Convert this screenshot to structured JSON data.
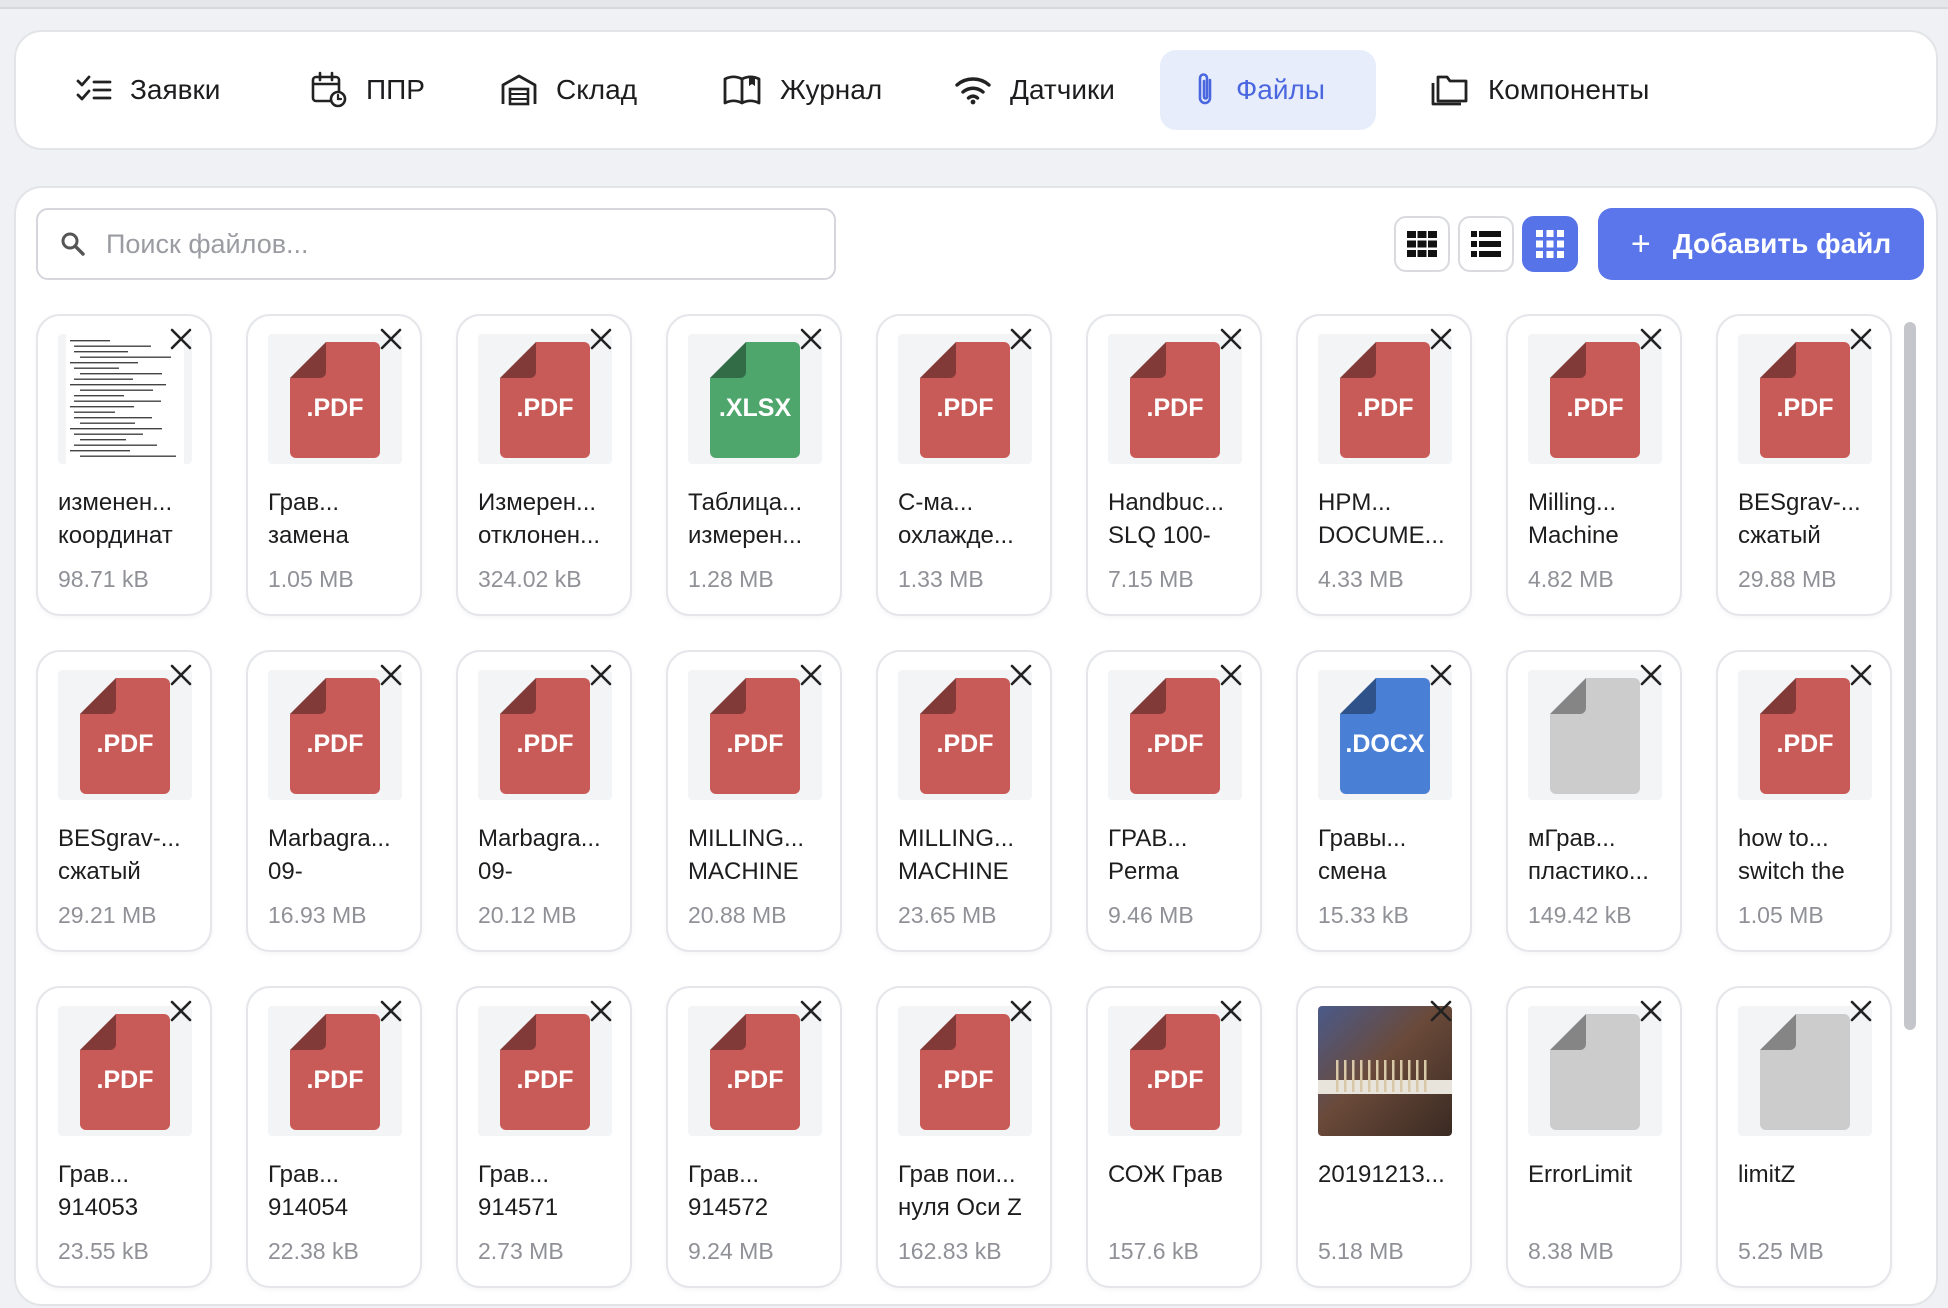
{
  "nav": {
    "items": [
      {
        "label": "Заявки",
        "icon": "checklist-icon"
      },
      {
        "label": "ППР",
        "icon": "calendar-refresh-icon"
      },
      {
        "label": "Склад",
        "icon": "warehouse-icon"
      },
      {
        "label": "Журнал",
        "icon": "book-icon"
      },
      {
        "label": "Датчики",
        "icon": "wifi-icon"
      },
      {
        "label": "Файлы",
        "icon": "paperclip-icon",
        "active": true
      },
      {
        "label": "Компоненты",
        "icon": "folders-icon"
      }
    ]
  },
  "search": {
    "placeholder": "Поиск файлов...",
    "value": ""
  },
  "toolbar": {
    "views": [
      "large-grid-icon",
      "list-icon",
      "small-grid-icon"
    ],
    "active_view": "small-grid-icon",
    "add_label": "Добавить файл",
    "add_icon": "plus-icon"
  },
  "colors": {
    "accent": "#5a76ea",
    "pdf": "#c85a57",
    "xlsx": "#4ea66c",
    "docx": "#4a7fd6",
    "unknown": "#cccccc"
  },
  "files": [
    {
      "type": "doc-preview",
      "ext": "",
      "line1": "изменен...",
      "line2": "координат",
      "size": "98.71 kB"
    },
    {
      "type": "pdf",
      "ext": ".PDF",
      "line1": "Грав...",
      "line2": "замена",
      "size": "1.05 MB"
    },
    {
      "type": "pdf",
      "ext": ".PDF",
      "line1": "Измерен...",
      "line2": "отклонен...",
      "size": "324.02 kB"
    },
    {
      "type": "xlsx",
      "ext": ".XLSX",
      "line1": "Таблица...",
      "line2": "измерен...",
      "size": "1.28 MB"
    },
    {
      "type": "pdf",
      "ext": ".PDF",
      "line1": "C-ма...",
      "line2": "охлажде...",
      "size": "1.33 MB"
    },
    {
      "type": "pdf",
      "ext": ".PDF",
      "line1": "Handbuc...",
      "line2": "SLQ 100-",
      "size": "7.15 MB"
    },
    {
      "type": "pdf",
      "ext": ".PDF",
      "line1": "HPM...",
      "line2": "DOCUME...",
      "size": "4.33 MB"
    },
    {
      "type": "pdf",
      "ext": ".PDF",
      "line1": "Milling...",
      "line2": "Machine",
      "size": "4.82 MB"
    },
    {
      "type": "pdf",
      "ext": ".PDF",
      "line1": "BESgrav-...",
      "line2": "сжатый",
      "size": "29.88 MB"
    },
    {
      "type": "pdf",
      "ext": ".PDF",
      "line1": "BESgrav-...",
      "line2": "сжатый",
      "size": "29.21 MB"
    },
    {
      "type": "pdf",
      "ext": ".PDF",
      "line1": "Marbagra...",
      "line2": "09-",
      "size": "16.93 MB"
    },
    {
      "type": "pdf",
      "ext": ".PDF",
      "line1": "Marbagra...",
      "line2": "09-",
      "size": "20.12 MB"
    },
    {
      "type": "pdf",
      "ext": ".PDF",
      "line1": "MILLING...",
      "line2": "MACHINE",
      "size": "20.88 MB"
    },
    {
      "type": "pdf",
      "ext": ".PDF",
      "line1": "MILLING...",
      "line2": "MACHINE",
      "size": "23.65 MB"
    },
    {
      "type": "pdf",
      "ext": ".PDF",
      "line1": "ГРАВ...",
      "line2": "Perma",
      "size": "9.46 MB"
    },
    {
      "type": "docx",
      "ext": ".DOCX",
      "line1": "Гравы...",
      "line2": "смена",
      "size": "15.33 kB"
    },
    {
      "type": "unknown",
      "ext": "",
      "line1": "мГрав...",
      "line2": "пластико...",
      "size": "149.42 kB"
    },
    {
      "type": "pdf",
      "ext": ".PDF",
      "line1": "how to...",
      "line2": "switch the",
      "size": "1.05 MB"
    },
    {
      "type": "pdf",
      "ext": ".PDF",
      "line1": "Грав...",
      "line2": "914053",
      "size": "23.55 kB"
    },
    {
      "type": "pdf",
      "ext": ".PDF",
      "line1": "Грав...",
      "line2": "914054",
      "size": "22.38 kB"
    },
    {
      "type": "pdf",
      "ext": ".PDF",
      "line1": "Грав...",
      "line2": "914571",
      "size": "2.73 MB"
    },
    {
      "type": "pdf",
      "ext": ".PDF",
      "line1": "Грав...",
      "line2": "914572",
      "size": "9.24 MB"
    },
    {
      "type": "pdf",
      "ext": ".PDF",
      "line1": "Грав пои...",
      "line2": "нуля Оси Z",
      "size": "162.83 kB"
    },
    {
      "type": "pdf",
      "ext": ".PDF",
      "line1": "СОЖ Грав",
      "line2": "",
      "size": "157.6 kB"
    },
    {
      "type": "photo",
      "ext": "",
      "line1": "20191213...",
      "line2": "",
      "size": "5.18 MB"
    },
    {
      "type": "unknown",
      "ext": "",
      "line1": "ErrorLimit",
      "line2": "",
      "size": "8.38 MB"
    },
    {
      "type": "unknown",
      "ext": "",
      "line1": "limitZ",
      "line2": "",
      "size": "5.25 MB"
    }
  ]
}
